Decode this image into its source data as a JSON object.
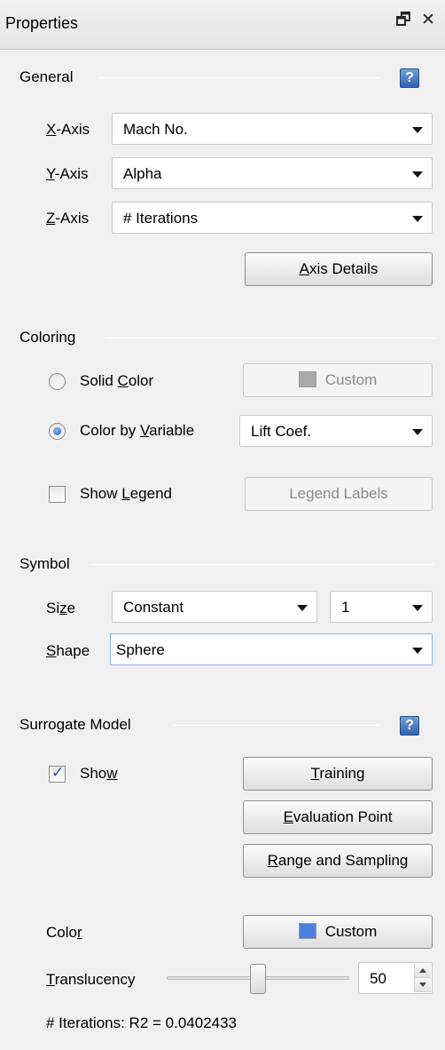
{
  "window": {
    "title": "Properties",
    "float_glyph": "🗗",
    "close_glyph": "✕"
  },
  "help_glyph": "?",
  "general": {
    "label": "General",
    "x_axis": {
      "label_mnemonic": "X",
      "label_rest": "-Axis",
      "value": "Mach No."
    },
    "y_axis": {
      "label_mnemonic": "Y",
      "label_rest": "-Axis",
      "value": "Alpha"
    },
    "z_axis": {
      "label_mnemonic": "Z",
      "label_rest": "-Axis",
      "value": "# Iterations"
    },
    "axis_details": {
      "mnemonic": "A",
      "rest": "xis Details"
    }
  },
  "coloring": {
    "label": "Coloring",
    "solid_color": {
      "pre": "Solid ",
      "mnemonic": "C",
      "post": "olor",
      "selected": false
    },
    "custom_button": "Custom",
    "color_by_variable": {
      "pre": "Color by ",
      "mnemonic": "V",
      "post": "ariable",
      "selected": true
    },
    "variable_value": "Lift Coef.",
    "show_legend": {
      "pre": "Show ",
      "mnemonic": "L",
      "post": "egend",
      "checked": false
    },
    "legend_labels": {
      "pre": "Le",
      "mnemonic": "g",
      "post": "end Labels"
    }
  },
  "symbol": {
    "label": "Symbol",
    "size": {
      "pre": "Si",
      "mnemonic": "z",
      "post": "e",
      "mode": "Constant",
      "value": "1"
    },
    "shape": {
      "mnemonic": "S",
      "rest": "hape",
      "value": "Sphere"
    }
  },
  "surrogate": {
    "label": "Surrogate Model",
    "show": {
      "pre": "Sho",
      "mnemonic": "w",
      "checked": true
    },
    "training": {
      "mnemonic": "T",
      "rest": "raining"
    },
    "evaluation_point": {
      "mnemonic": "E",
      "rest": "valuation Point"
    },
    "range_sampling": {
      "mnemonic": "R",
      "rest": "ange and Sampling"
    },
    "color_label": {
      "pre": "Colo",
      "mnemonic": "r"
    },
    "color_button": "Custom",
    "translucency": {
      "mnemonic": "T",
      "rest": "ranslucency",
      "value": "50",
      "fraction": 0.5
    },
    "status": "# Iterations: R2 = 0.0402433"
  },
  "colors": {
    "solid_swatch": "#a9a9a9",
    "surrogate_swatch": "#4a7fe0"
  }
}
